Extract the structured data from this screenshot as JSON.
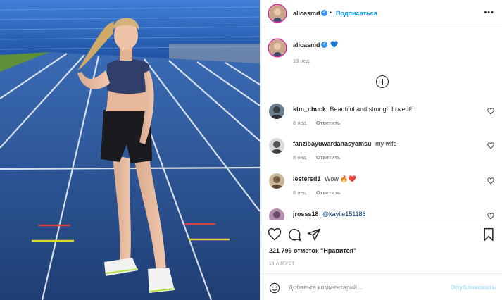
{
  "post": {
    "author": "alicasmd",
    "follow_label": "Подписаться",
    "more_glyph": "•••",
    "caption_emoji": "💙",
    "caption_age": "13 нед.",
    "likes": "221 799 отметок \"Нравится\"",
    "date": "19 АВГУСТ",
    "reply_label": "Ответить"
  },
  "comments": [
    {
      "user": "ktm_chuck",
      "text": "Beautiful and strong!! Love it!!",
      "age": "8 нед."
    },
    {
      "user": "fanzibayuwardanasyamsu",
      "text": "my wife",
      "age": "8 нед."
    },
    {
      "user": "lestersd1",
      "text": "Wow 🔥❤️",
      "age": "8 нед."
    },
    {
      "user": "jrosss18",
      "text": "@kaylie151188",
      "age": ""
    }
  ],
  "composer": {
    "placeholder": "Добавьте комментарий...",
    "publish_label": "Опубликовать"
  },
  "colors": {
    "link_blue": "#0095f6",
    "track_blue": "#2c4f8f",
    "heart_red": "#ed4956"
  }
}
